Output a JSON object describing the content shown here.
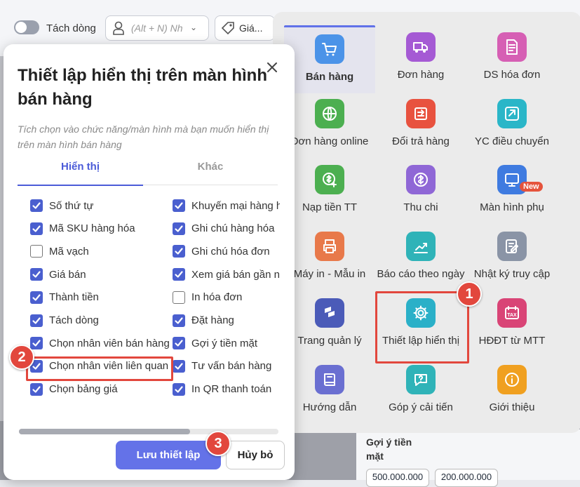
{
  "background": {
    "toggle_label": "Tách dòng",
    "employee_placeholder": "(Alt + N) Nh",
    "price_label": "Giá...",
    "suggest_title": "Gợi ý tiền mặt",
    "chips": [
      "500.000.000",
      "200.000.000"
    ]
  },
  "menu": {
    "items": [
      {
        "label": "Bán hàng",
        "icon": "cart-icon",
        "color": "#4b93e8",
        "active": true
      },
      {
        "label": "Đơn hàng",
        "icon": "truck-icon",
        "color": "#a55ad4"
      },
      {
        "label": "DS hóa đơn",
        "icon": "invoice-icon",
        "color": "#d65fb4"
      },
      {
        "label": "Đơn hàng online",
        "icon": "globe-icon",
        "color": "#4caf50"
      },
      {
        "label": "Đổi trả hàng",
        "icon": "return-icon",
        "color": "#e8523f"
      },
      {
        "label": "YC điều chuyển",
        "icon": "transfer-icon",
        "color": "#2ab6c8"
      },
      {
        "label": "Nạp tiền TT",
        "icon": "topup-icon",
        "color": "#4caf50"
      },
      {
        "label": "Thu chi",
        "icon": "dollar-icon",
        "color": "#8f67d6"
      },
      {
        "label": "Màn hình phụ",
        "icon": "monitor-icon",
        "color": "#3f7be0",
        "badge": "New"
      },
      {
        "label": "Máy in - Mẫu in",
        "icon": "printer-icon",
        "color": "#e8794a"
      },
      {
        "label": "Báo cáo theo ngày",
        "icon": "report-icon",
        "color": "#2fb3b8"
      },
      {
        "label": "Nhật ký truy cập",
        "icon": "log-icon",
        "color": "#8a94a6"
      },
      {
        "label": "Trang quản lý",
        "icon": "manage-icon",
        "color": "#4b5bb8"
      },
      {
        "label": "Thiết lập hiển thị",
        "icon": "gear-icon",
        "color": "#2ab0c8"
      },
      {
        "label": "HĐĐT từ MTT",
        "icon": "tax-icon",
        "color": "#d94476"
      },
      {
        "label": "Hướng dẫn",
        "icon": "book-icon",
        "color": "#6a6fd1"
      },
      {
        "label": "Góp ý cải tiến",
        "icon": "feedback-icon",
        "color": "#2fb3b8"
      },
      {
        "label": "Giới thiệu",
        "icon": "info-icon",
        "color": "#f0a020"
      }
    ]
  },
  "dialog": {
    "title": "Thiết lập hiển thị trên màn hình bán hàng",
    "description": "Tích chọn vào chức năng/màn hình mà bạn muốn hiển thị trên màn hình bán hàng",
    "tabs": [
      "Hiển thị",
      "Khác"
    ],
    "left_column": [
      {
        "label": "Số thứ tự",
        "checked": true
      },
      {
        "label": "Mã SKU hàng hóa",
        "checked": true
      },
      {
        "label": "Mã vạch",
        "checked": false
      },
      {
        "label": "Giá bán",
        "checked": true
      },
      {
        "label": "Thành tiền",
        "checked": true
      },
      {
        "label": "Tách dòng",
        "checked": true
      },
      {
        "label": "Chọn nhân viên bán hàng",
        "checked": true
      },
      {
        "label": "Chọn nhân viên liên quan",
        "checked": true
      },
      {
        "label": "Chọn bảng giá",
        "checked": true
      }
    ],
    "right_column": [
      {
        "label": "Khuyến mại hàng hóa",
        "checked": true
      },
      {
        "label": "Ghi chú hàng hóa",
        "checked": true
      },
      {
        "label": "Ghi chú hóa đơn",
        "checked": true
      },
      {
        "label": "Xem giá bán gần nhất",
        "checked": true
      },
      {
        "label": "In hóa đơn",
        "checked": false
      },
      {
        "label": "Đặt hàng",
        "checked": true
      },
      {
        "label": "Gợi ý tiền mặt",
        "checked": true
      },
      {
        "label": "Tư vấn bán hàng",
        "checked": true
      },
      {
        "label": "In QR thanh toán",
        "checked": true
      }
    ],
    "scroll_position": 0.66,
    "save_label": "Lưu thiết lập",
    "cancel_label": "Hủy bỏ"
  },
  "markers": [
    "1",
    "2",
    "3"
  ],
  "colors": {
    "accent": "#4b5bd8",
    "highlight": "#e2473d",
    "primary_button": "#6472e8"
  }
}
